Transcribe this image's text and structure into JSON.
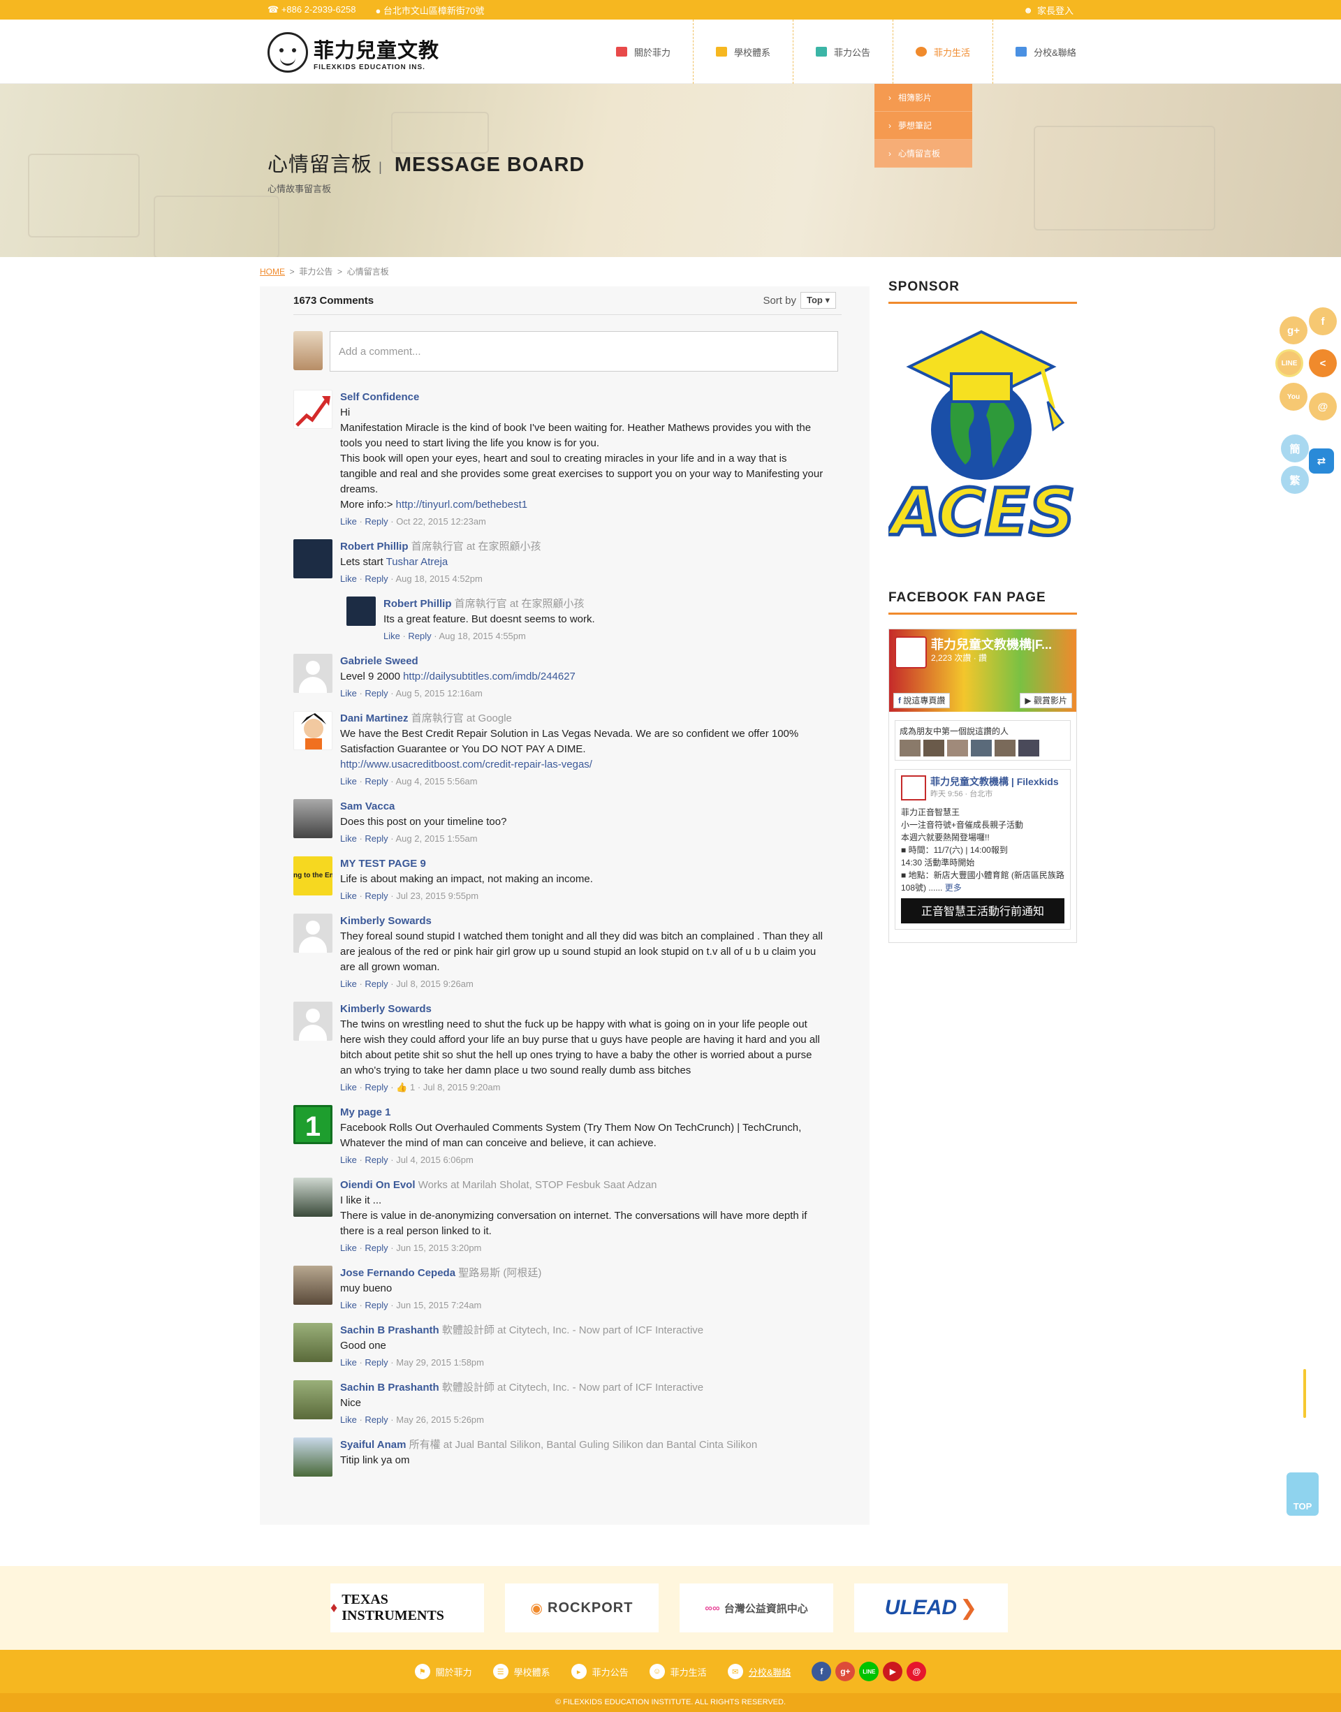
{
  "topbar": {
    "phone": "+886 2-2939-6258",
    "address": "台北市文山區樟新街70號",
    "login": "家長登入"
  },
  "logo": {
    "title": "菲力兒童文教",
    "subtitle": "FILEXKIDS EDUCATION INS."
  },
  "nav": {
    "items": [
      {
        "label": "關於菲力",
        "icon": "flag-icon",
        "color": "#e84a4a"
      },
      {
        "label": "學校體系",
        "icon": "book-icon",
        "color": "#f6b720"
      },
      {
        "label": "菲力公告",
        "icon": "megaphone-icon",
        "color": "#3bb5a6"
      },
      {
        "label": "菲力生活",
        "icon": "people-icon",
        "color": "#f08a2c"
      },
      {
        "label": "分校&聯絡",
        "icon": "mail-icon",
        "color": "#4a90e2"
      }
    ],
    "dropdown": [
      "相簿影片",
      "夢想筆記",
      "心情留言板"
    ]
  },
  "banner": {
    "title_zh": "心情留言板",
    "separator": "|",
    "title_en": "MESSAGE BOARD",
    "subtitle": "心情故事留言板"
  },
  "breadcrumb": {
    "home": "HOME",
    "sep": ">",
    "level1": "菲力公告",
    "level2": "心情留言板"
  },
  "comments": {
    "count": "1673 Comments",
    "sort_label": "Sort by",
    "sort_value": "Top",
    "placeholder": "Add a comment...",
    "like": "Like",
    "reply": "Reply",
    "items": [
      {
        "name": "Self Confidence",
        "meta": "",
        "lines": [
          "Hi",
          "Manifestation Miracle is the kind of book I've been waiting for. Heather Mathews provides you with the tools you need to start living the life you know is for you.",
          "This book will open your eyes, heart and soul to creating miracles in your life and in a way that is tangible and real and she provides some great exercises to support you on your way to Manifesting your dreams."
        ],
        "more_label": "More info:>",
        "link": "http://tinyurl.com/bethebest1",
        "date": "Oct 22, 2015 12:23am"
      },
      {
        "name": "Robert Phillip",
        "meta": "首席執行官 at 在家照顧小孩",
        "text": "Lets start",
        "link": "Tushar Atreja",
        "date": "Aug 18, 2015 4:52pm"
      },
      {
        "name": "Robert Phillip",
        "meta": "首席執行官 at 在家照顧小孩",
        "text": "Its a great feature. But doesnt seems to work.",
        "date": "Aug 18, 2015 4:55pm"
      },
      {
        "name": "Gabriele Sweed",
        "meta": "",
        "text": "Level 9 2000",
        "link": "http://dailysubtitles.com/imdb/244627",
        "date": "Aug 5, 2015 12:16am"
      },
      {
        "name": "Dani Martinez",
        "meta": "首席執行官 at Google",
        "text": "We have the Best Credit Repair Solution in Las Vegas Nevada. We are so confident we offer 100% Satisfaction Guarantee or You DO NOT PAY A DIME.",
        "link": "http://www.usacreditboost.com/credit-repair-las-vegas/",
        "date": "Aug 4, 2015 5:56am"
      },
      {
        "name": "Sam Vacca",
        "meta": "",
        "text": "Does this post on your timeline too?",
        "date": "Aug 2, 2015 1:55am"
      },
      {
        "name": "MY TEST PAGE 9",
        "meta": "",
        "avatar_text": "ng to the En",
        "text": "Life is about making an impact, not making an income.",
        "date": "Jul 23, 2015 9:55pm"
      },
      {
        "name": "Kimberly Sowards",
        "meta": "",
        "text": "They foreal sound stupid I watched them tonight and all they did was bitch an complained . Than they all are jealous of the red or pink hair girl grow up u sound stupid an look stupid on t.v all of u b u claim you are all grown woman.",
        "date": "Jul 8, 2015 9:26am"
      },
      {
        "name": "Kimberly Sowards",
        "meta": "",
        "text": "The twins on wrestling need to shut the fuck up be happy with what is going on in your life people out here wish they could afford your life an buy purse that u guys have people are having it hard and you all bitch about petite shit so shut the hell up ones trying to have a baby the other is worried about a purse an who's trying to take her damn place u two sound really dumb ass bitches",
        "likes": "1",
        "date": "Jul 8, 2015 9:20am"
      },
      {
        "name": "My page 1",
        "meta": "",
        "avatar_text": "1",
        "text": "Facebook Rolls Out Overhauled Comments System (Try Them Now On TechCrunch) | TechCrunch, Whatever the mind of man can conceive and believe, it can achieve.",
        "date": "Jul 4, 2015 6:06pm"
      },
      {
        "name": "Oiendi On Evol",
        "meta": "Works at Marilah Sholat, STOP Fesbuk Saat Adzan",
        "lines": [
          "I like it ...",
          "There is value in de-anonymizing conversation on internet. The conversations will have more depth if there is a real person linked to it."
        ],
        "date": "Jun 15, 2015 3:20pm"
      },
      {
        "name": "Jose Fernando Cepeda",
        "meta": "聖路易斯 (阿根廷)",
        "text": "muy bueno",
        "date": "Jun 15, 2015 7:24am"
      },
      {
        "name": "Sachin B Prashanth",
        "meta": "軟體設計師 at Citytech, Inc. - Now part of ICF Interactive",
        "text": "Good one",
        "date": "May 29, 2015 1:58pm"
      },
      {
        "name": "Sachin B Prashanth",
        "meta": "軟體設計師 at Citytech, Inc. - Now part of ICF Interactive",
        "text": "Nice",
        "date": "May 26, 2015 5:26pm"
      },
      {
        "name": "Syaiful Anam",
        "meta": "所有權 at Jual Bantal Silikon, Bantal Guling Silikon dan Bantal Cinta Silikon",
        "text": "Titip link ya om",
        "date": ""
      }
    ]
  },
  "sidebar": {
    "sponsor_title": "SPONSOR",
    "aces_label": "ACES",
    "fb_title": "FACEBOOK FAN PAGE",
    "fb": {
      "page_name": "菲力兒童文教機構|F...",
      "fans": "2,223 次讚 · 讚",
      "like_btn": "說這專頁讚",
      "video_btn": "觀賞影片",
      "friends_label": "成為朋友中第一個說這讚的人",
      "post_name": "菲力兒童文教機構 | Filexkids",
      "post_time": "昨天 9:56 · 台北市",
      "post_lines": [
        "菲力正音智慧王",
        "小一注音符號+音催成長親子活動",
        "本週六就要熱鬧登場囉!!",
        "■ 時間：11/7(六) | 14:00報到",
        "14:30 活動準時開始",
        "■ 地點：新店大豐國小體育館 (新店區民族路108號) ......"
      ],
      "more": "更多",
      "banner_text": "正音智慧王活動行前通知"
    }
  },
  "floating": {
    "lang_simplified": "簡",
    "lang_traditional": "繁",
    "top": "TOP"
  },
  "sponsors": [
    "TEXAS INSTRUMENTS",
    "ROCKPORT",
    "台灣公益資訊中心",
    "ULEAD"
  ],
  "footer": {
    "nav": [
      "關於菲力",
      "學校體系",
      "菲力公告",
      "菲力生活",
      "分校&聯絡"
    ],
    "copyright": "© FILEXKIDS EDUCATION INSTITUTE. ALL RIGHTS RESERVED."
  },
  "colors": {
    "brand_yellow": "#f6b720",
    "brand_orange": "#f08a2c",
    "fb_blue": "#3b5998"
  }
}
